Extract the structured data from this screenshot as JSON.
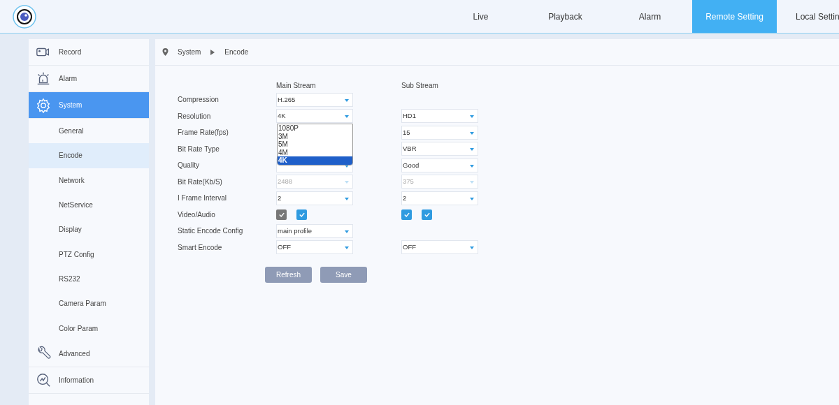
{
  "nav": {
    "tabs": [
      {
        "label": "Live",
        "selected": false
      },
      {
        "label": "Playback",
        "selected": false
      },
      {
        "label": "Alarm",
        "selected": false
      },
      {
        "label": "Remote Setting",
        "selected": true
      },
      {
        "label": "Local Settin",
        "selected": false
      }
    ]
  },
  "sidebar": {
    "items": [
      {
        "label": "Record",
        "selected": false
      },
      {
        "label": "Alarm",
        "selected": false
      },
      {
        "label": "System",
        "selected": true,
        "children": [
          {
            "label": "General",
            "selected": false
          },
          {
            "label": "Encode",
            "selected": true
          },
          {
            "label": "Network",
            "selected": false
          },
          {
            "label": "NetService",
            "selected": false
          },
          {
            "label": "Display",
            "selected": false
          },
          {
            "label": "PTZ Config",
            "selected": false
          },
          {
            "label": "RS232",
            "selected": false
          },
          {
            "label": "Camera Param",
            "selected": false
          },
          {
            "label": "Color Param",
            "selected": false
          }
        ]
      },
      {
        "label": "Advanced",
        "selected": false
      },
      {
        "label": "Information",
        "selected": false
      }
    ]
  },
  "breadcrumb": [
    "System",
    "Encode"
  ],
  "form": {
    "columns": [
      "Main Stream",
      "Sub Stream"
    ],
    "rows": [
      {
        "label": "Compression",
        "kind": "select",
        "main": {
          "value": "H.265"
        }
      },
      {
        "label": "Resolution",
        "kind": "select",
        "main": {
          "value": "4K",
          "open": true,
          "options": [
            {
              "label": "1080P",
              "selected": false
            },
            {
              "label": "3M",
              "selected": false
            },
            {
              "label": "5M",
              "selected": false
            },
            {
              "label": "4M",
              "selected": false
            },
            {
              "label": "4K",
              "selected": true
            }
          ]
        },
        "sub": {
          "value": "HD1"
        }
      },
      {
        "label": "Frame Rate(fps)",
        "kind": "select",
        "sub": {
          "value": "15"
        }
      },
      {
        "label": "Bit Rate Type",
        "kind": "select",
        "sub": {
          "value": "VBR"
        }
      },
      {
        "label": "Quality",
        "kind": "select",
        "main": {},
        "sub": {
          "value": "Good"
        }
      },
      {
        "label": "Bit Rate(Kb/S)",
        "kind": "select",
        "main": {
          "value": "2488",
          "disabled": true
        },
        "sub": {
          "value": "375",
          "disabled": true
        }
      },
      {
        "label": "I Frame Interval",
        "kind": "select",
        "main": {
          "value": "2"
        },
        "sub": {
          "value": "2"
        }
      },
      {
        "label": "Video/Audio",
        "kind": "checks",
        "main": [
          {
            "checked": true,
            "disabled": true
          },
          {
            "checked": true,
            "disabled": false
          }
        ],
        "sub": [
          {
            "checked": true,
            "disabled": false
          },
          {
            "checked": true,
            "disabled": false
          }
        ]
      },
      {
        "label": "Static Encode Config",
        "kind": "select",
        "main": {
          "value": "main profile"
        }
      },
      {
        "label": "Smart Encode",
        "kind": "select",
        "main": {
          "value": "OFF"
        },
        "sub": {
          "value": "OFF"
        }
      }
    ]
  },
  "buttons": [
    "Refresh",
    "Save"
  ]
}
